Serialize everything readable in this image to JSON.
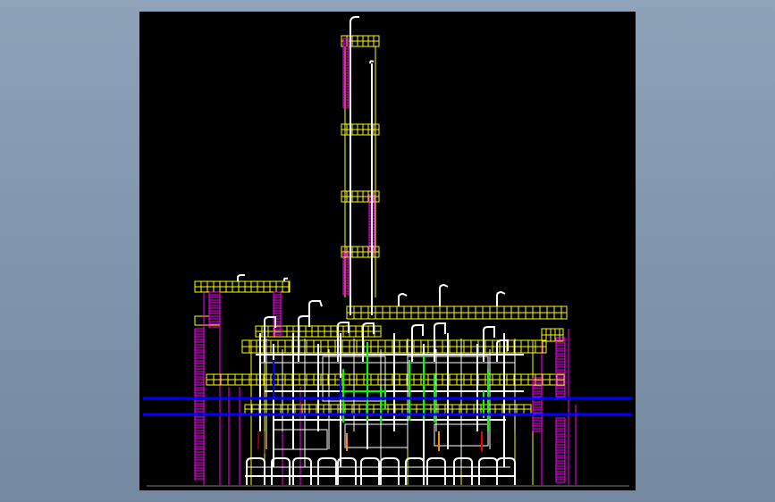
{
  "viewer": {
    "background": "#8496ac",
    "canvas_background": "#000000"
  },
  "palette": {
    "structure": "#ffff00",
    "ladder": "#ff00ff",
    "piping": "#ffffff",
    "utility_line": "#0000ff",
    "process_line": "#00ff00",
    "accent": "#ff0000",
    "accent2": "#ff8c00",
    "ground": "#808080"
  }
}
